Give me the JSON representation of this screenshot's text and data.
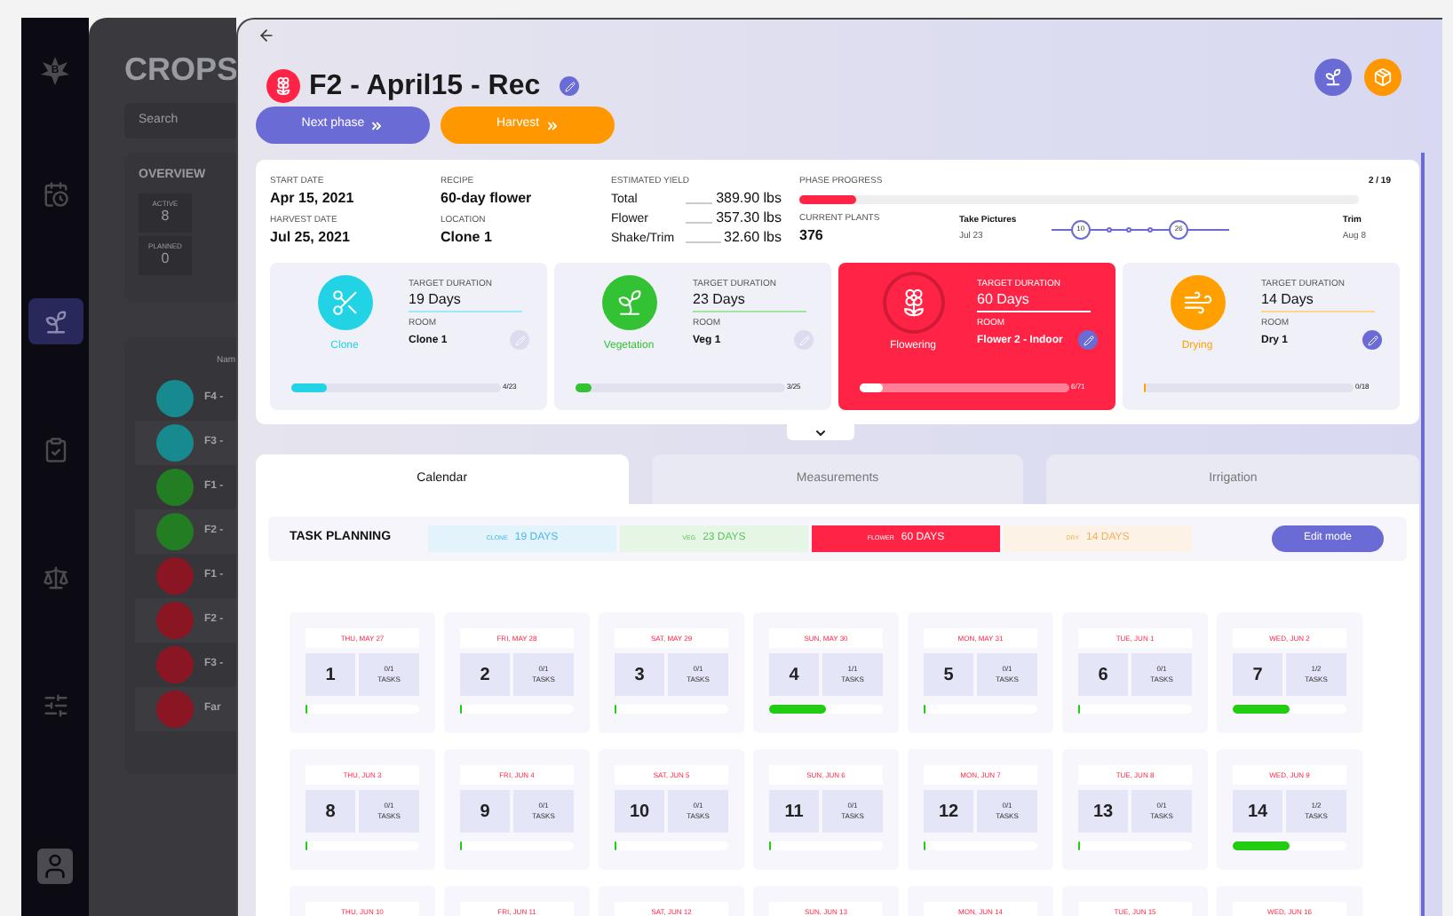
{
  "sidebar": {
    "logo_letter": "B",
    "items": [
      {
        "selected": false
      },
      {
        "selected": true
      },
      {
        "selected": false
      },
      {
        "selected": false
      },
      {
        "selected": false
      }
    ]
  },
  "background": {
    "title": "CROPS",
    "search_placeholder": "Search",
    "overview": {
      "title": "OVERVIEW",
      "stats": [
        {
          "label": "ACTIVE",
          "value": "8"
        },
        {
          "label": "PLANNED",
          "value": "0"
        }
      ]
    },
    "list": {
      "column_1": "Nam",
      "rows": [
        {
          "name": "F4 -",
          "color": "#168a8f"
        },
        {
          "name": "F3 -",
          "color": "#168a8f"
        },
        {
          "name": "F1 -",
          "color": "#237d22"
        },
        {
          "name": "F2 -",
          "color": "#237d22"
        },
        {
          "name": "F1 -",
          "color": "#8a1624"
        },
        {
          "name": "F2 -",
          "color": "#8a1624"
        },
        {
          "name": "F3 -",
          "color": "#8a1624"
        },
        {
          "name": "Far",
          "color": "#8a1624"
        }
      ]
    }
  },
  "crop": {
    "title": "F2 - April15 - Rec",
    "actions": [
      {
        "label": "Next phase",
        "kind": "primary"
      },
      {
        "label": "Harvest",
        "kind": "warning"
      }
    ]
  },
  "summary": {
    "start_date": {
      "label": "START DATE",
      "value": "Apr 15, 2021"
    },
    "harvest_date": {
      "label": "HARVEST DATE",
      "value": "Jul 25, 2021"
    },
    "recipe": {
      "label": "RECIPE",
      "value": "60-day flower"
    },
    "location": {
      "label": "LOCATION",
      "value": "Clone 1"
    },
    "estimated_yield": {
      "label": "ESTIMATED YIELD",
      "rows": [
        {
          "label": "Total",
          "value": "389.90 lbs"
        },
        {
          "label": "Flower",
          "value": "357.30 lbs"
        },
        {
          "label": "Shake/Trim",
          "value": "32.60 lbs"
        }
      ]
    },
    "phase_progress": {
      "label": "PHASE PROGRESS",
      "count": "2 / 19",
      "level": 0.1
    },
    "current_plants": {
      "label": "CURRENT PLANTS",
      "value": "376"
    },
    "timeline": {
      "start": {
        "label": "Take Pictures",
        "date": "Jul 23"
      },
      "markers": [
        "10",
        "26"
      ],
      "end": {
        "label": "Trim",
        "date": "Aug 8"
      }
    }
  },
  "phases": [
    {
      "kind": "clone",
      "name": "Clone",
      "color": "#22d3e6",
      "selected": false,
      "duration_label": "TARGET DURATION",
      "duration": "19 Days",
      "room_label": "ROOM",
      "room": "Clone 1",
      "editable": false,
      "level": 0.17,
      "count": "4/23"
    },
    {
      "kind": "vegetation",
      "name": "Vegetation",
      "color": "#33c233",
      "selected": false,
      "duration_label": "TARGET DURATION",
      "duration": "23 Days",
      "room_label": "ROOM",
      "room": "Veg 1",
      "editable": false,
      "level": 0.08,
      "count": "3/25"
    },
    {
      "kind": "flowering",
      "name": "Flowering",
      "color": "#ff2446",
      "selected": true,
      "duration_label": "TARGET DURATION",
      "duration": "60 Days",
      "room_label": "ROOM",
      "room": "Flower 2 - Indoor",
      "editable": true,
      "level": 0.11,
      "count": "6/71"
    },
    {
      "kind": "drying",
      "name": "Drying",
      "color": "#ffa000",
      "selected": false,
      "duration_label": "TARGET DURATION",
      "duration": "14 Days",
      "room_label": "ROOM",
      "room": "Dry 1",
      "editable": true,
      "level": 0,
      "count": "0/18"
    }
  ],
  "tabs": [
    {
      "label": "Calendar",
      "selected": true
    },
    {
      "label": "Measurements",
      "selected": false
    },
    {
      "label": "Irrigation",
      "selected": false
    }
  ],
  "task_planning": {
    "title": "TASK PLANNING",
    "edit_button": "Edit mode",
    "phases": [
      {
        "label": "CLONE",
        "days": "19 DAYS",
        "color": "#4cb6e6",
        "selected": false
      },
      {
        "label": "VEG",
        "days": "23 DAYS",
        "color": "#5ec45e",
        "selected": false
      },
      {
        "label": "FLOWER",
        "days": "60 DAYS",
        "color": "#ff2446",
        "selected": true
      },
      {
        "label": "DRY",
        "days": "14 DAYS",
        "color": "#f2b060",
        "selected": false
      }
    ]
  },
  "calendar": {
    "weeks": [
      {
        "days": [
          {
            "date": "THU, MAY 27",
            "number": "1",
            "tasks": "0/1",
            "tasks_label": "TASKS",
            "level": 0
          },
          {
            "date": "FRI, MAY 28",
            "number": "2",
            "tasks": "0/1",
            "tasks_label": "TASKS",
            "level": 0
          },
          {
            "date": "SAT, MAY 29",
            "number": "3",
            "tasks": "0/1",
            "tasks_label": "TASKS",
            "level": 0
          },
          {
            "date": "SUN, MAY 30",
            "number": "4",
            "tasks": "1/1",
            "tasks_label": "TASKS",
            "level": 0.5
          },
          {
            "date": "MON, MAY 31",
            "number": "5",
            "tasks": "0/1",
            "tasks_label": "TASKS",
            "level": 0
          },
          {
            "date": "TUE, JUN 1",
            "number": "6",
            "tasks": "0/1",
            "tasks_label": "TASKS",
            "level": 0
          },
          {
            "date": "WED, JUN 2",
            "number": "7",
            "tasks": "1/2",
            "tasks_label": "TASKS",
            "level": 0.5
          }
        ]
      },
      {
        "days": [
          {
            "date": "THU, JUN 3",
            "number": "8",
            "tasks": "0/1",
            "tasks_label": "TASKS",
            "level": 0
          },
          {
            "date": "FRI, JUN 4",
            "number": "9",
            "tasks": "0/1",
            "tasks_label": "TASKS",
            "level": 0
          },
          {
            "date": "SAT, JUN 5",
            "number": "10",
            "tasks": "0/1",
            "tasks_label": "TASKS",
            "level": 0
          },
          {
            "date": "SUN, JUN 6",
            "number": "11",
            "tasks": "0/1",
            "tasks_label": "TASKS",
            "level": 0
          },
          {
            "date": "MON, JUN 7",
            "number": "12",
            "tasks": "0/1",
            "tasks_label": "TASKS",
            "level": 0
          },
          {
            "date": "TUE, JUN 8",
            "number": "13",
            "tasks": "0/1",
            "tasks_label": "TASKS",
            "level": 0
          },
          {
            "date": "WED, JUN 9",
            "number": "14",
            "tasks": "1/2",
            "tasks_label": "TASKS",
            "level": 0.5
          }
        ]
      },
      {
        "days": [
          {
            "date": "THU, JUN 10"
          },
          {
            "date": "FRI, JUN 11"
          },
          {
            "date": "SAT, JUN 12"
          },
          {
            "date": "SUN, JUN 13"
          },
          {
            "date": "MON, JUN 14"
          },
          {
            "date": "TUE, JUN 15"
          },
          {
            "date": "WED, JUN 16"
          }
        ]
      }
    ]
  }
}
